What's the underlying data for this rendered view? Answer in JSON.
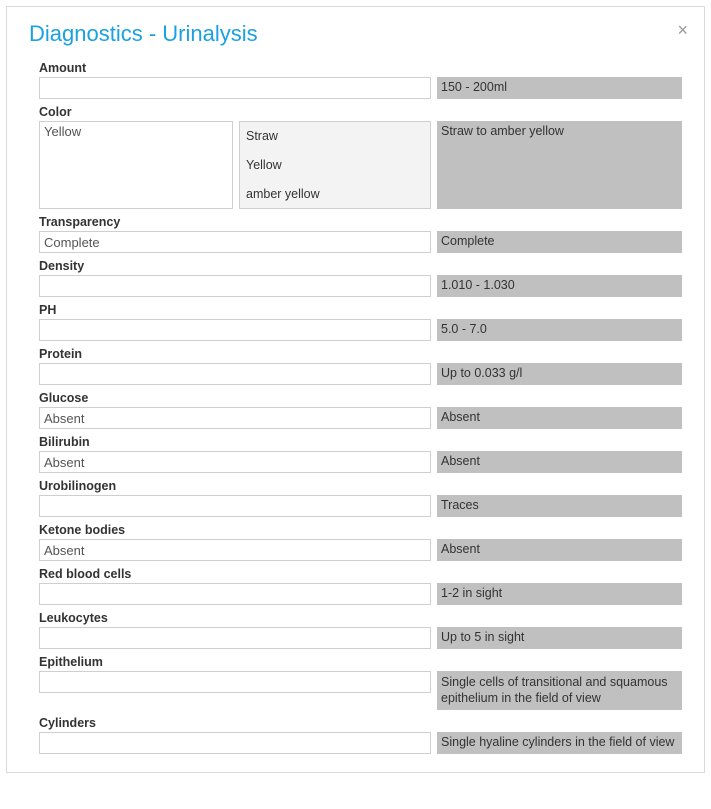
{
  "title": "Diagnostics - Urinalysis",
  "closeGlyph": "×",
  "fields": {
    "amount": {
      "label": "Amount",
      "value": "",
      "ref": "150 - 200ml"
    },
    "color": {
      "label": "Color",
      "value": "Yellow",
      "ref": "Straw to amber yellow",
      "options": [
        "Straw",
        "Yellow",
        "amber yellow"
      ]
    },
    "transparency": {
      "label": "Transparency",
      "value": "Complete",
      "ref": "Complete"
    },
    "density": {
      "label": "Density",
      "value": "",
      "ref": "1.010 - 1.030"
    },
    "ph": {
      "label": "PH",
      "value": "",
      "ref": "5.0 - 7.0"
    },
    "protein": {
      "label": "Protein",
      "value": "",
      "ref": "Up to 0.033 g/l"
    },
    "glucose": {
      "label": "Glucose",
      "value": "Absent",
      "ref": "Absent"
    },
    "bilirubin": {
      "label": "Bilirubin",
      "value": "Absent",
      "ref": "Absent"
    },
    "urobilinogen": {
      "label": "Urobilinogen",
      "value": "",
      "ref": "Traces"
    },
    "ketone": {
      "label": "Ketone bodies",
      "value": "Absent",
      "ref": "Absent"
    },
    "rbc": {
      "label": "Red blood cells",
      "value": "",
      "ref": "1-2 in sight"
    },
    "leukocytes": {
      "label": "Leukocytes",
      "value": "",
      "ref": "Up to 5 in sight"
    },
    "epithelium": {
      "label": "Epithelium",
      "value": "",
      "ref": "Single cells of transitional and squamous epithelium in the field of view"
    },
    "cylinders": {
      "label": "Cylinders",
      "value": "",
      "ref": "Single hyaline cylinders in the field of view"
    }
  }
}
